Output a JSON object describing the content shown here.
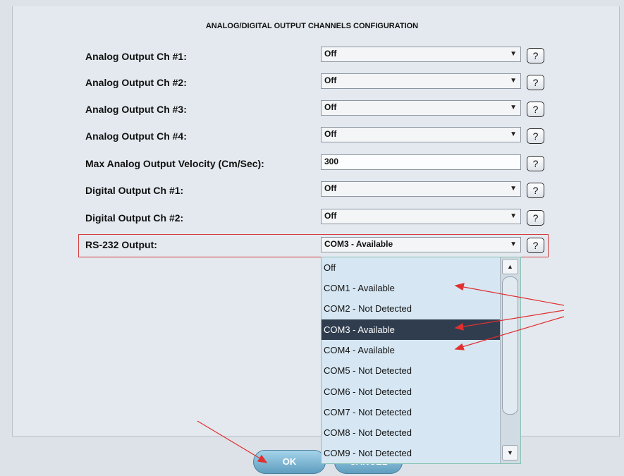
{
  "title": "ANALOG/DIGITAL OUTPUT CHANNELS CONFIGURATION",
  "rows": [
    {
      "label": "Analog Output Ch #1:",
      "value": "Off",
      "type": "select"
    },
    {
      "label": "Analog Output Ch #2:",
      "value": "Off",
      "type": "select"
    },
    {
      "label": "Analog Output Ch #3:",
      "value": "Off",
      "type": "select"
    },
    {
      "label": "Analog Output Ch #4:",
      "value": "Off",
      "type": "select"
    },
    {
      "label": "Max Analog Output Velocity (Cm/Sec):",
      "value": "300",
      "type": "input"
    },
    {
      "label": "Digital Output Ch #1:",
      "value": "Off",
      "type": "select"
    },
    {
      "label": "Digital Output Ch #2:",
      "value": "Off",
      "type": "select"
    },
    {
      "label": "RS-232 Output:",
      "value": "COM3 - Available",
      "type": "select"
    }
  ],
  "help_label": "?",
  "dropdown": {
    "options": [
      "Off",
      "COM1 - Available",
      "COM2 - Not Detected",
      "COM3 - Available",
      "COM4 - Available",
      "COM5 - Not Detected",
      "COM6 - Not Detected",
      "COM7 - Not Detected",
      "COM8 - Not Detected",
      "COM9 - Not Detected"
    ],
    "selected_index": 3
  },
  "buttons": {
    "ok": "OK",
    "cancel": "CANCEL"
  },
  "colors": {
    "highlight": "#d43c3c",
    "selected_bg": "#2f3d4f",
    "button": "#6aa8c8"
  },
  "icons": {
    "dropdown": "triangle-down-icon",
    "scroll_up": "scroll-up-icon",
    "scroll_down": "scroll-down-icon"
  }
}
